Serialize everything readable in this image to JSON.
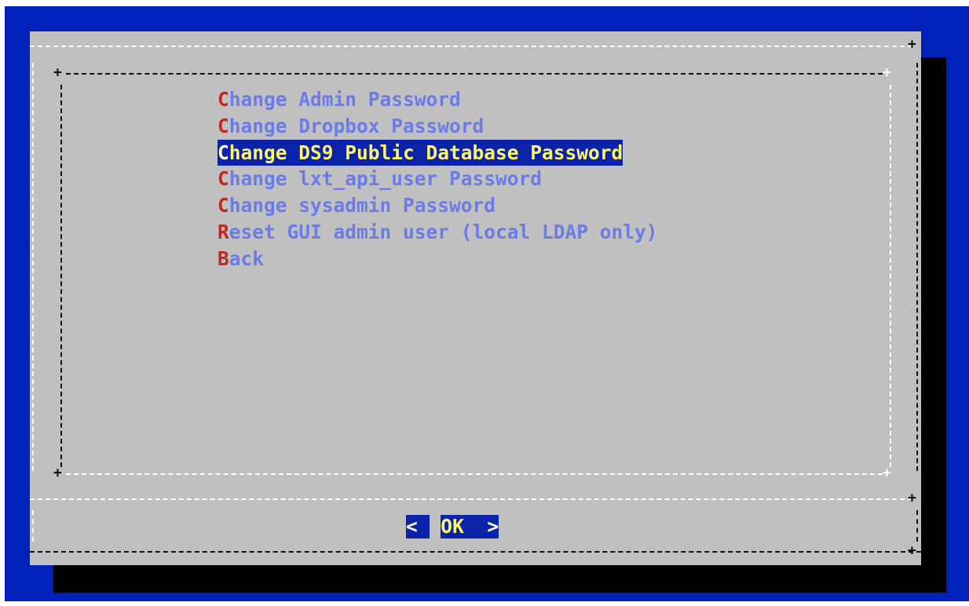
{
  "menu": {
    "items": [
      {
        "hot": "C",
        "rest": "hange Admin Password",
        "selected": false
      },
      {
        "hot": "C",
        "rest": "hange Dropbox Password",
        "selected": false
      },
      {
        "hot": "C",
        "rest": "hange DS9 Public Database Password",
        "selected": true
      },
      {
        "hot": "C",
        "rest": "hange lxt_api_user Password",
        "selected": false
      },
      {
        "hot": "C",
        "rest": "hange sysadmin Password",
        "selected": false
      },
      {
        "hot": "R",
        "rest": "eset GUI admin user (local LDAP only)",
        "selected": false
      },
      {
        "hot": "B",
        "rest": "ack",
        "selected": false
      }
    ]
  },
  "buttons": {
    "ok": {
      "left": "<",
      "hot": "O",
      "rest": "K",
      "right": ">"
    }
  },
  "colors": {
    "background": "#0022bb",
    "dialog": "#c0c0c0",
    "item_text": "#6b7be8",
    "hotkey": "#c3271f",
    "selected_bg": "#0a23a8",
    "selected_text": "#fff56a"
  }
}
